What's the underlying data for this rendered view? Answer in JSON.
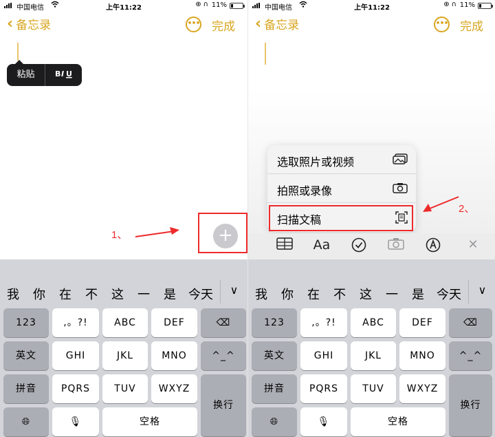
{
  "status": {
    "carrier": "中国电信",
    "time": "上午11:22",
    "battery": "11%"
  },
  "nav": {
    "back_label": "备忘录",
    "done_label": "完成"
  },
  "callout": {
    "paste": "粘贴",
    "biu": "BIU"
  },
  "steps": {
    "one": "1、",
    "two": "2、"
  },
  "menu": {
    "items": [
      {
        "label": "选取照片或视频",
        "icon": "photos-icon"
      },
      {
        "label": "拍照或录像",
        "icon": "camera-icon"
      },
      {
        "label": "扫描文稿",
        "icon": "scan-doc-icon"
      }
    ]
  },
  "toolbar": {
    "icons": [
      "table-icon",
      "text-format-icon",
      "checklist-icon",
      "camera-icon",
      "markup-icon",
      "close-icon"
    ],
    "text_format_label": "Aa"
  },
  "keyboard": {
    "candidates": [
      "我",
      "你",
      "在",
      "不",
      "这",
      "一",
      "是",
      "今天"
    ],
    "rows": [
      [
        "123",
        ",。?!",
        "ABC",
        "DEF"
      ],
      [
        "英文",
        "GHI",
        "JKL",
        "MNO",
        "^_^"
      ],
      [
        "拼音",
        "PQRS",
        "TUV",
        "WXYZ",
        "换行"
      ],
      [
        "空格"
      ]
    ]
  },
  "colors": {
    "accent": "#d9a621",
    "highlight": "#ee2a2a"
  }
}
